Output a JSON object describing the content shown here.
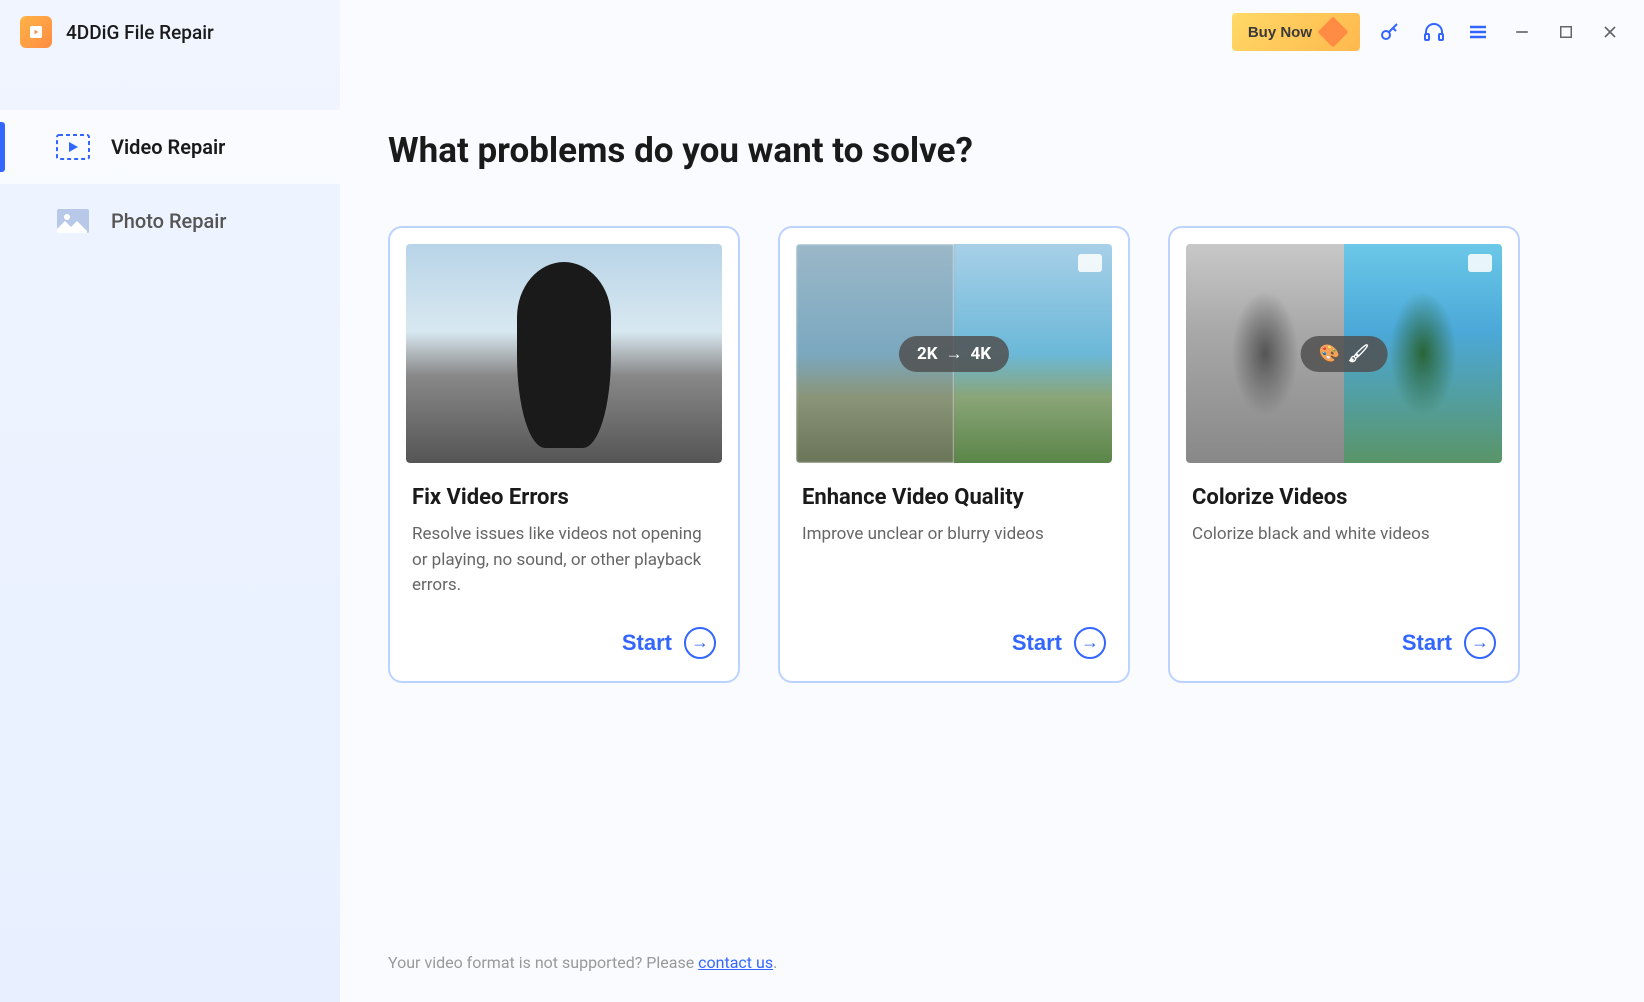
{
  "app": {
    "title": "4DDiG File Repair"
  },
  "titlebar": {
    "buy_now_label": "Buy Now"
  },
  "sidebar": {
    "items": [
      {
        "label": "Video Repair",
        "active": true
      },
      {
        "label": "Photo Repair",
        "active": false
      }
    ]
  },
  "main": {
    "heading": "What problems do you want to solve?",
    "cards": [
      {
        "title": "Fix Video Errors",
        "description": "Resolve issues like videos not opening or playing, no sound, or other playback errors.",
        "start_label": "Start"
      },
      {
        "title": "Enhance Video Quality",
        "description": "Improve unclear or blurry videos",
        "badge_left": "2K",
        "badge_right": "4K",
        "start_label": "Start"
      },
      {
        "title": "Colorize Videos",
        "description": "Colorize black and white videos",
        "start_label": "Start"
      }
    ]
  },
  "footer": {
    "prompt": "Your video format is not supported? Please ",
    "link_text": "contact us",
    "suffix": "."
  }
}
